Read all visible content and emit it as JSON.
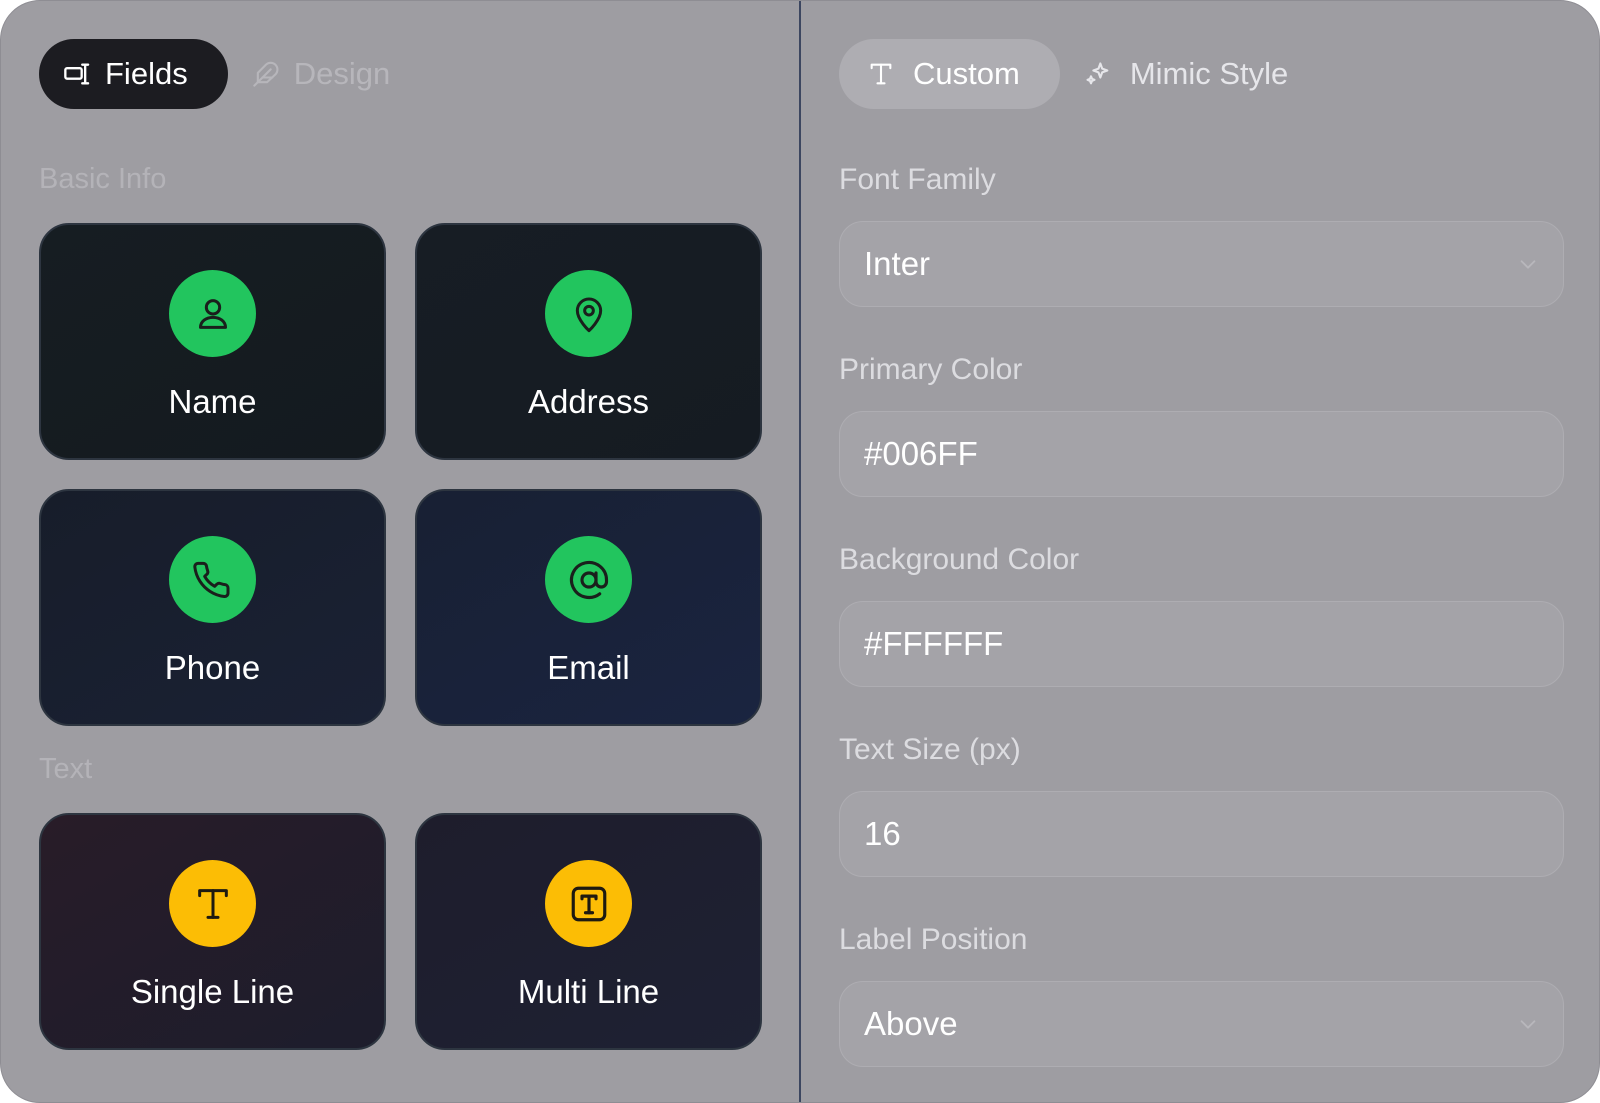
{
  "left_panel": {
    "tabs": [
      {
        "label": "Fields",
        "icon": "fields-icon",
        "active": true
      },
      {
        "label": "Design",
        "icon": "feather-icon",
        "active": false
      }
    ],
    "sections": [
      {
        "title": "Basic Info",
        "items": [
          {
            "label": "Name",
            "icon": "user-icon"
          },
          {
            "label": "Address",
            "icon": "map-pin-icon"
          },
          {
            "label": "Phone",
            "icon": "phone-icon"
          },
          {
            "label": "Email",
            "icon": "at-sign-icon"
          }
        ]
      },
      {
        "title": "Text",
        "items": [
          {
            "label": "Single Line",
            "icon": "type-icon"
          },
          {
            "label": "Multi Line",
            "icon": "text-box-icon"
          }
        ]
      }
    ]
  },
  "right_panel": {
    "tabs": [
      {
        "label": "Custom",
        "icon": "type-icon",
        "active": true
      },
      {
        "label": "Mimic Style",
        "icon": "sparkles-icon",
        "active": false
      }
    ],
    "fields": {
      "font_family": {
        "label": "Font Family",
        "value": "Inter",
        "kind": "select"
      },
      "primary_color": {
        "label": "Primary Color",
        "value": "#006FF",
        "kind": "input"
      },
      "background_color": {
        "label": "Background Color",
        "value": "#FFFFFF",
        "kind": "input"
      },
      "text_size": {
        "label": "Text Size (px)",
        "value": "16",
        "kind": "input"
      },
      "label_position": {
        "label": "Label Position",
        "value": "Above",
        "kind": "select"
      }
    }
  },
  "colors": {
    "panel_bg": "#9e9da2",
    "contact_icon_bg": "#22c55e",
    "text_icon_bg": "#fcbd05",
    "active_tab_bg": "#1c1c21",
    "divider": "#3c4660"
  }
}
